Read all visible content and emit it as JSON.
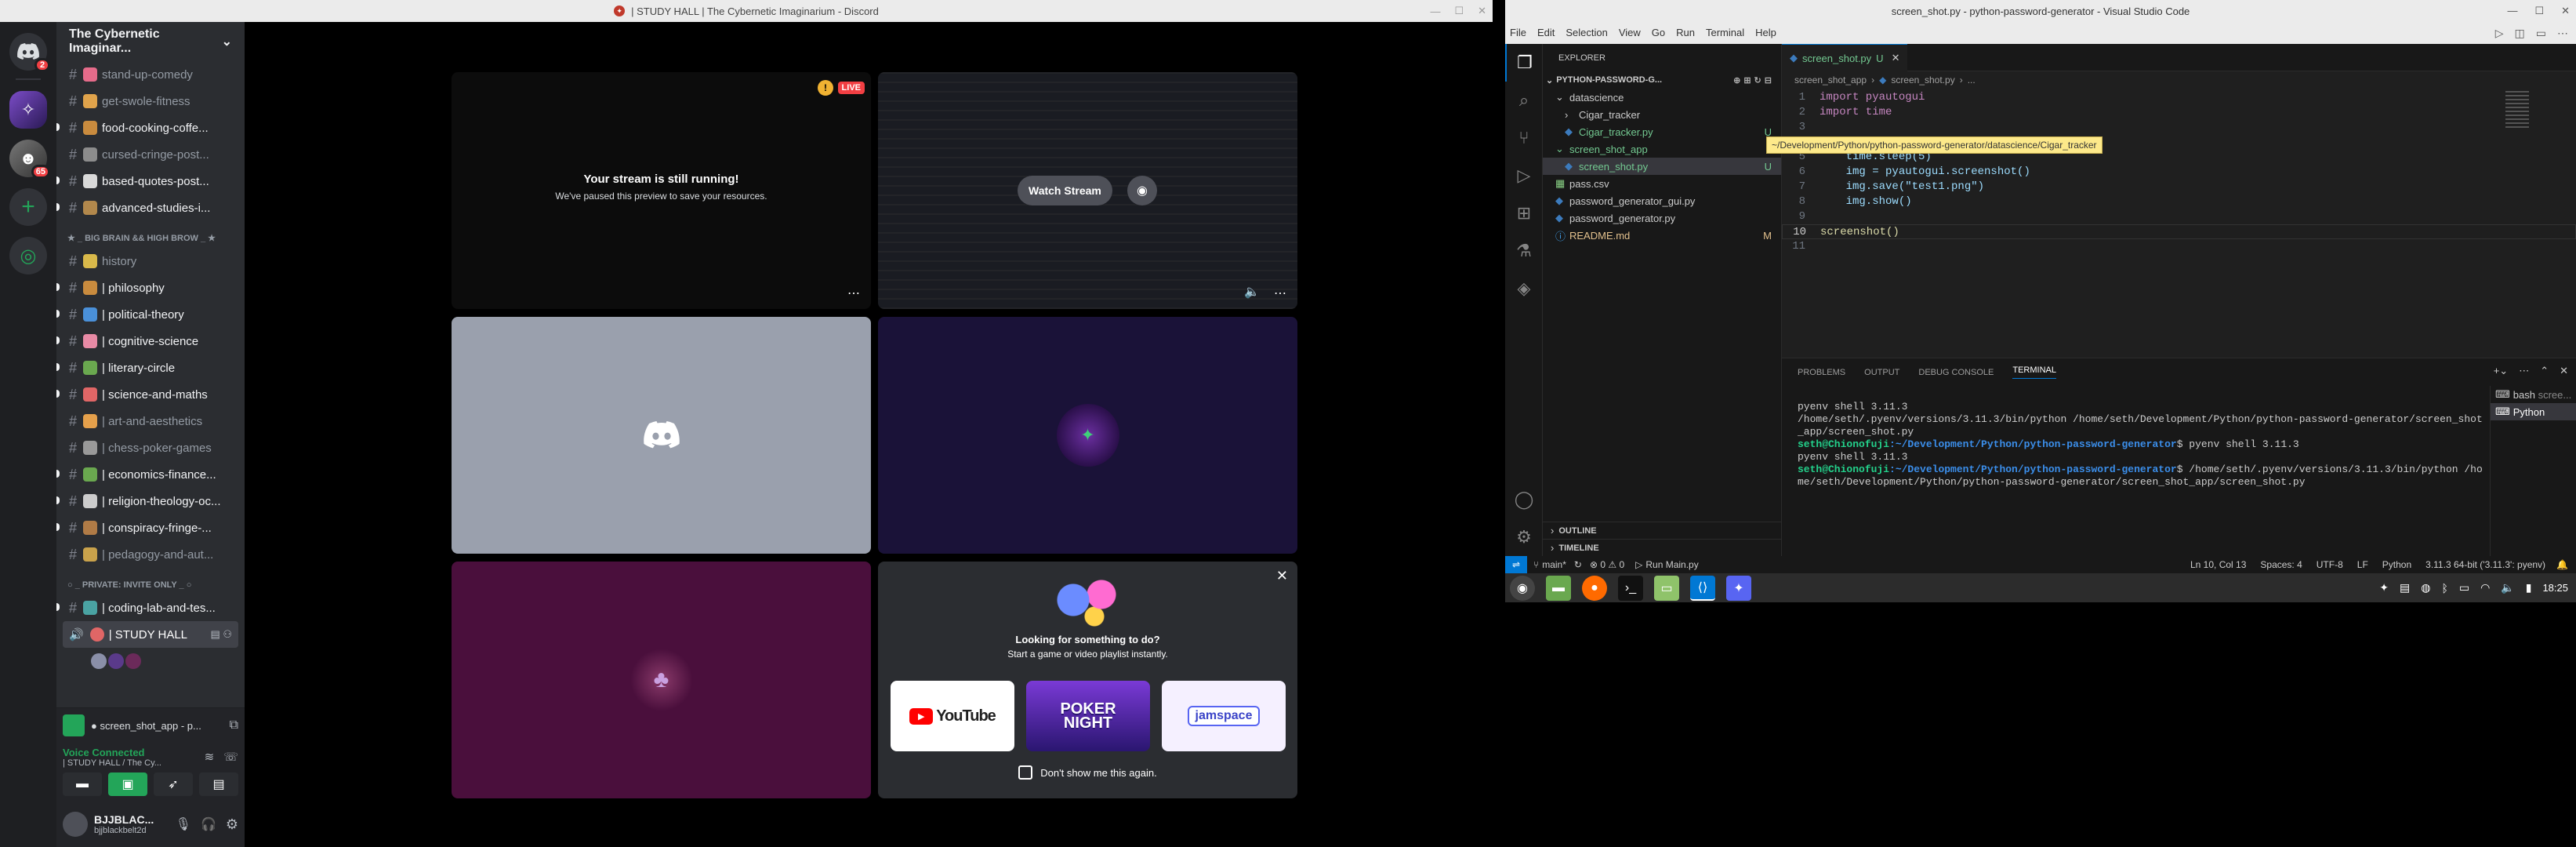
{
  "discord": {
    "window_title": "| STUDY HALL | The Cybernetic Imaginarium - Discord",
    "rail_badges": [
      "2",
      "65"
    ],
    "server_name": "The Cybernetic Imaginar...",
    "channels_top": [
      {
        "name": "stand-up-comedy",
        "emoji_color": "#e56b8a",
        "unread": false
      },
      {
        "name": "get-swole-fitness",
        "emoji_color": "#e0a34b",
        "unread": false
      },
      {
        "name": "food-cooking-coffe...",
        "emoji_color": "#c98b3e",
        "unread": true
      },
      {
        "name": "cursed-cringe-post...",
        "emoji_color": "#8c8c8c",
        "unread": false
      },
      {
        "name": "based-quotes-post...",
        "emoji_color": "#d9d9d9",
        "unread": true
      },
      {
        "name": "advanced-studies-i...",
        "emoji_color": "#b2884c",
        "unread": true
      }
    ],
    "category_1": "★ _ BIG BRAIN && HIGH BROW _ ★",
    "channels_mid": [
      {
        "name": "history",
        "emoji_color": "#d9b94a",
        "unread": false
      },
      {
        "name": "| philosophy",
        "emoji_color": "#c98b3e",
        "unread": true
      },
      {
        "name": "| political-theory",
        "emoji_color": "#4a90d9",
        "unread": true
      },
      {
        "name": "| cognitive-science",
        "emoji_color": "#e88aa5",
        "unread": true
      },
      {
        "name": "| literary-circle",
        "emoji_color": "#6aa84f",
        "unread": true
      },
      {
        "name": "| science-and-maths",
        "emoji_color": "#e06666",
        "unread": true
      },
      {
        "name": "| art-and-aesthetics",
        "emoji_color": "#e5a04b",
        "unread": false
      },
      {
        "name": "| chess-poker-games",
        "emoji_color": "#999999",
        "unread": false
      },
      {
        "name": "| economics-finance...",
        "emoji_color": "#6aa84f",
        "unread": true
      },
      {
        "name": "| religion-theology-oc...",
        "emoji_color": "#cccccc",
        "unread": true
      },
      {
        "name": "| conspiracy-fringe-...",
        "emoji_color": "#b07b46",
        "unread": true
      },
      {
        "name": "| pedagogy-and-aut...",
        "emoji_color": "#c9a24b",
        "unread": false
      }
    ],
    "category_2": "○ _ PRIVATE: INVITE ONLY _ ○",
    "channels_private": [
      {
        "name": "| coding-lab-and-tes...",
        "emoji_color": "#4aa3a3",
        "unread": true
      }
    ],
    "voice_channel": "| STUDY HALL",
    "stream_card": "● screen_shot_app - p...",
    "voice_status": "Voice Connected",
    "voice_sub": "| STUDY HALL / The Cy...",
    "user_name": "BJJBLAC...",
    "user_tag": "bjjblackbelt2d",
    "tile1_live": "LIVE",
    "tile1_title": "Your stream is still running!",
    "tile1_sub": "We've paused this preview to save your resources.",
    "tile2_button": "Watch Stream",
    "activity_title": "Looking for something to do?",
    "activity_sub": "Start a game or video playlist instantly.",
    "activities": [
      "YouTube",
      "POKER NIGHT",
      "jamspace"
    ],
    "activity_checkbox": "Don't show me this again.",
    "colors": {
      "tile3": "#9aa0ad",
      "tile4": "#1a1238",
      "tile5": "#4a0f3c",
      "accent": "#23a559"
    }
  },
  "vscode": {
    "window_title": "screen_shot.py - python-password-generator - Visual Studio Code",
    "menu": [
      "File",
      "Edit",
      "Selection",
      "View",
      "Go",
      "Run",
      "Terminal",
      "Help"
    ],
    "explorer_label": "EXPLORER",
    "project": "PYTHON-PASSWORD-G...",
    "tree": [
      {
        "label": "datascience",
        "indent": 1,
        "type": "folder",
        "color": "#ccc",
        "badge": ""
      },
      {
        "label": "Cigar_tracker",
        "indent": 2,
        "type": "folder",
        "color": "#ccc",
        "badge": ""
      },
      {
        "label": "Cigar_tracker.py",
        "indent": 2,
        "type": "py",
        "color": "#73c991",
        "badge": "U"
      },
      {
        "label": "screen_shot_app",
        "indent": 1,
        "type": "folder",
        "color": "#73c991",
        "badge": ""
      },
      {
        "label": "screen_shot.py",
        "indent": 2,
        "type": "py",
        "color": "#73c991",
        "badge": "U"
      },
      {
        "label": "pass.csv",
        "indent": 1,
        "type": "csv",
        "color": "#ccc",
        "badge": ""
      },
      {
        "label": "password_generator_gui.py",
        "indent": 1,
        "type": "py",
        "color": "#ccc",
        "badge": ""
      },
      {
        "label": "password_generator.py",
        "indent": 1,
        "type": "py",
        "color": "#ccc",
        "badge": ""
      },
      {
        "label": "README.md",
        "indent": 1,
        "type": "md",
        "color": "#e2c08d",
        "badge": "M"
      }
    ],
    "outline": "OUTLINE",
    "timeline": "TIMELINE",
    "tab": "screen_shot.py",
    "tab_badge": "U",
    "breadcrumb": [
      "screen_shot_app",
      "screen_shot.py",
      "..."
    ],
    "tooltip": "~/Development/Python/python-password-generator/datascience/Cigar_tracker",
    "code_lines": [
      {
        "n": "1",
        "text": "import pyautogui"
      },
      {
        "n": "2",
        "text": "import time"
      },
      {
        "n": "3",
        "text": ""
      },
      {
        "n": "4",
        "text": ""
      },
      {
        "n": "5",
        "text": "    time.sleep(5)"
      },
      {
        "n": "6",
        "text": "    img = pyautogui.screenshot()"
      },
      {
        "n": "7",
        "text": "    img.save(\"test1.png\")"
      },
      {
        "n": "8",
        "text": "    img.show()"
      },
      {
        "n": "9",
        "text": ""
      },
      {
        "n": "10",
        "text": "screenshot()"
      },
      {
        "n": "11",
        "text": ""
      }
    ],
    "panel_tabs": [
      "PROBLEMS",
      "OUTPUT",
      "DEBUG CONSOLE",
      "TERMINAL"
    ],
    "terminal_lines": [
      "pyenv shell 3.11.3",
      "/home/seth/.pyenv/versions/3.11.3/bin/python /home/seth/Development/Python/python-password-generator/screen_shot",
      "_app/screen_shot.py"
    ],
    "prompt_user": "seth@Chionofuji",
    "prompt_path": ":~/Development/Python/python-password-generator",
    "cmd1": "$ pyenv shell 3.11.3",
    "cmd2": "$ /home/seth/.pyenv/versions/3.11.3/bin/python /ho",
    "cmd2_wrap": "me/seth/Development/Python/python-password-generator/screen_shot_app/screen_shot.py",
    "term_list": [
      "bash",
      "Python"
    ],
    "status_branch": "main*",
    "status_errors": "⊗ 0 ⚠ 0",
    "status_run": "Run Main.py",
    "status_right": [
      "Ln 10, Col 13",
      "Spaces: 4",
      "UTF-8",
      "LF",
      "Python",
      "3.11.3 64-bit ('3.11.3': pyenv)"
    ],
    "clock": "18:25"
  }
}
